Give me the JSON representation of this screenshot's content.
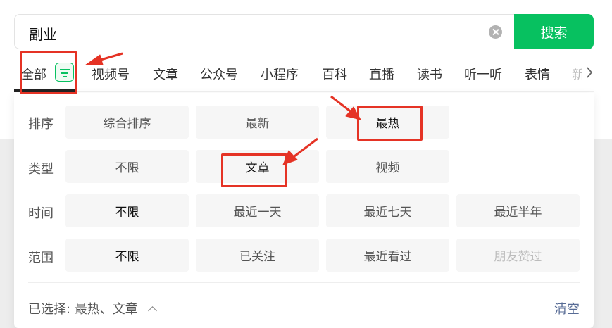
{
  "search": {
    "query": "副业",
    "button_label": "搜索"
  },
  "tabs": [
    {
      "label": "全部"
    },
    {
      "label": "视频号"
    },
    {
      "label": "文章"
    },
    {
      "label": "公众号"
    },
    {
      "label": "小程序"
    },
    {
      "label": "百科"
    },
    {
      "label": "直播"
    },
    {
      "label": "读书"
    },
    {
      "label": "听一听"
    },
    {
      "label": "表情"
    },
    {
      "label": "新"
    }
  ],
  "filters": {
    "sort": {
      "label": "排序",
      "options": [
        "综合排序",
        "最新",
        "最热"
      ]
    },
    "type": {
      "label": "类型",
      "options": [
        "不限",
        "文章",
        "视频"
      ]
    },
    "time": {
      "label": "时间",
      "options": [
        "不限",
        "最近一天",
        "最近七天",
        "最近半年"
      ]
    },
    "scope": {
      "label": "范围",
      "options": [
        "不限",
        "已关注",
        "最近看过",
        "朋友赞过"
      ]
    }
  },
  "footer": {
    "selected_label": "已选择:",
    "selected_values": "最热、文章",
    "clear_label": "清空"
  },
  "colors": {
    "accent": "#07c160",
    "annotation": "#e53325",
    "link": "#576b95"
  },
  "icons": {
    "clear": "clear-icon",
    "filter": "filter-icon",
    "chevron": "chevron-right-icon",
    "caret": "chevron-up-icon"
  }
}
